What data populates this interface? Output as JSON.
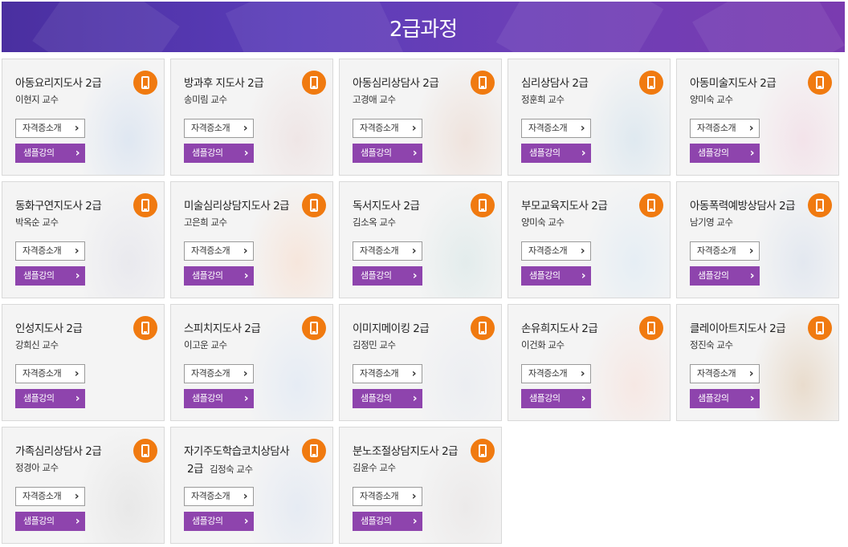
{
  "header": {
    "title": "2급과정"
  },
  "cards": [
    {
      "title": "아동요리지도사 2급",
      "professor": "이현지 교수",
      "intro_label": "자격증소개",
      "sample_label": "샘플강의",
      "art": "child-chef-photo",
      "tone": "#dfe7f2"
    },
    {
      "title": "방과후 지도사 2급",
      "professor": "송미림 교수",
      "intro_label": "자격증소개",
      "sample_label": "샘플강의",
      "art": "girl-holding-paper-photo",
      "tone": "#efe6e6"
    },
    {
      "title": "아동심리상담사 2급",
      "professor": "고경애 교수",
      "intro_label": "자격증소개",
      "sample_label": "샘플강의",
      "art": "mother-and-child-photo",
      "tone": "#efe3dd"
    },
    {
      "title": "심리상담사 2급",
      "professor": "정훈희 교수",
      "intro_label": "자격증소개",
      "sample_label": "샘플강의",
      "art": "thinking-girl-photo",
      "tone": "#dfe9f0"
    },
    {
      "title": "아동미술지도사 2급",
      "professor": "양미숙 교수",
      "intro_label": "자격증소개",
      "sample_label": "샘플강의",
      "art": "painting-child-photo",
      "tone": "#f3e3ea"
    },
    {
      "title": "동화구연지도사 2급",
      "professor": "박옥순 교수",
      "intro_label": "자격증소개",
      "sample_label": "샘플강의",
      "art": "reading-mother-photo",
      "tone": "#e9e9ee"
    },
    {
      "title": "미술심리상담지도사 2급",
      "professor": "고은희 교수",
      "intro_label": "자격증소개",
      "sample_label": "샘플강의",
      "art": "crayon-drawing-photo",
      "tone": "#f6e6dc"
    },
    {
      "title": "독서지도사 2급",
      "professor": "김소옥 교수",
      "intro_label": "자격증소개",
      "sample_label": "샘플강의",
      "art": "boy-with-books-photo",
      "tone": "#e3ecec"
    },
    {
      "title": "부모교육지도사 2급",
      "professor": "양미숙 교수",
      "intro_label": "자격증소개",
      "sample_label": "샘플강의",
      "art": "mother-and-baby-photo",
      "tone": "#e6eef4"
    },
    {
      "title": "아동폭력예방상담사 2급",
      "professor": "남기영 교수",
      "intro_label": "자격증소개",
      "sample_label": "샘플강의",
      "art": "upset-boy-photo",
      "tone": "#e3e8f0"
    },
    {
      "title": "인성지도사 2급",
      "professor": "강희신 교수",
      "intro_label": "자격증소개",
      "sample_label": "샘플강의",
      "art": "flower-and-cloud-illustration",
      "tone": "#f4f4f4"
    },
    {
      "title": "스피치지도사 2급",
      "professor": "이고운 교수",
      "intro_label": "자격증소개",
      "sample_label": "샘플강의",
      "art": "speaking-man-photo",
      "tone": "#e6ecf4"
    },
    {
      "title": "이미지메이킹 2급",
      "professor": "김정민 교수",
      "intro_label": "자격증소개",
      "sample_label": "샘플강의",
      "art": "businessman-thumbs-up-photo",
      "tone": "#eceef2"
    },
    {
      "title": "손유희지도사 2급",
      "professor": "이건화 교수",
      "intro_label": "자격증소개",
      "sample_label": "샘플강의",
      "art": "hands-paper-people-photo",
      "tone": "#f6e8e4"
    },
    {
      "title": "클레이아트지도사 2급",
      "professor": "정진숙 교수",
      "intro_label": "자격증소개",
      "sample_label": "샘플강의",
      "art": "clay-figures-photo",
      "tone": "#e9dccd"
    },
    {
      "title": "가족심리상담사 2급",
      "professor": "정경아 교수",
      "intro_label": "자격증소개",
      "sample_label": "샘플강의",
      "art": "family-group-photo",
      "tone": "#e8e8e8"
    },
    {
      "title": "자기주도학습코치상담사",
      "title_line2": "2급",
      "professor": "김정숙 교수",
      "intro_label": "자격증소개",
      "sample_label": "샘플강의",
      "art": "student-boy-photo",
      "tone": "#e6ebf3"
    },
    {
      "title": "분노조절상담지도사 2급",
      "professor": "김윤수 교수",
      "intro_label": "자격증소개",
      "sample_label": "샘플강의",
      "art": "angry-man-photo",
      "tone": "#eceaea"
    }
  ],
  "colors": {
    "header_start": "#4a2fa0",
    "header_end": "#7a3bb0",
    "sample_button": "#8e44ad",
    "mobile_badge": "#f07a10"
  }
}
